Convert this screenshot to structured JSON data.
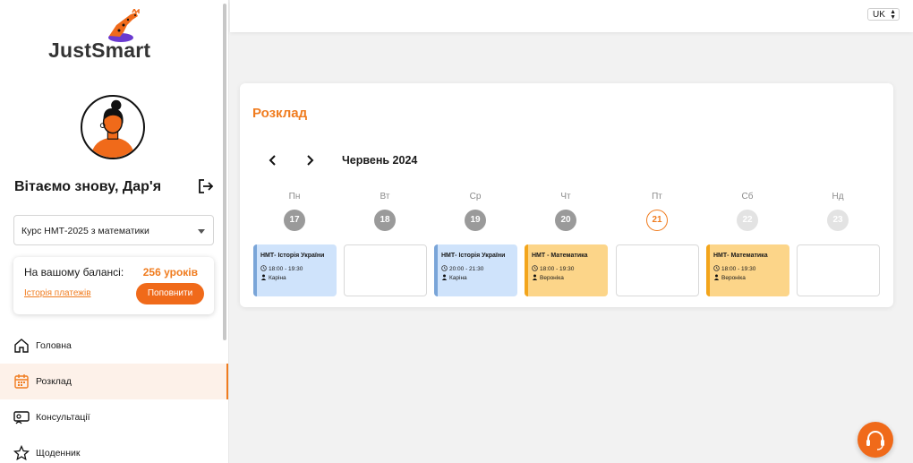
{
  "brand": {
    "logo_text": "JustSmart",
    "accent": "#f07c1f"
  },
  "sidebar": {
    "welcome": "Вітаємо знову, Дар'я",
    "course": "Курс НМТ-2025 з математики",
    "balance": {
      "label": "На вашому балансі:",
      "value": "256 уроків",
      "history": "Історія платежів",
      "topup": "Поповнити"
    },
    "nav": [
      {
        "label": "Головна",
        "icon": "home-icon"
      },
      {
        "label": "Розклад",
        "icon": "calendar-icon",
        "active": true
      },
      {
        "label": "Консультації",
        "icon": "chat-icon"
      },
      {
        "label": "Щоденник",
        "icon": "star-icon"
      }
    ]
  },
  "topbar": {
    "language": "UK"
  },
  "schedule": {
    "title": "Розклад",
    "month": "Червень 2024",
    "days": [
      {
        "name": "Пн",
        "num": "17",
        "state": "past",
        "lesson": {
          "title": "НМТ- Історія України",
          "time": "18:00 - 19:30",
          "teacher": "Каріна",
          "color": "blue"
        }
      },
      {
        "name": "Вт",
        "num": "18",
        "state": "past",
        "lesson": null
      },
      {
        "name": "Ср",
        "num": "19",
        "state": "past",
        "lesson": {
          "title": "НМТ- Історія України",
          "time": "20:00 - 21:30",
          "teacher": "Каріна",
          "color": "blue"
        }
      },
      {
        "name": "Чт",
        "num": "20",
        "state": "past",
        "lesson": {
          "title": "НМТ - Математика",
          "time": "18:00 - 19:30",
          "teacher": "Вероніка",
          "color": "orange"
        }
      },
      {
        "name": "Пт",
        "num": "21",
        "state": "today",
        "lesson": null
      },
      {
        "name": "Сб",
        "num": "22",
        "state": "future",
        "lesson": {
          "title": "НМТ- Математика",
          "time": "18:00 - 19:30",
          "teacher": "Вероніка",
          "color": "orange"
        }
      },
      {
        "name": "Нд",
        "num": "23",
        "state": "future",
        "lesson": null
      }
    ]
  }
}
